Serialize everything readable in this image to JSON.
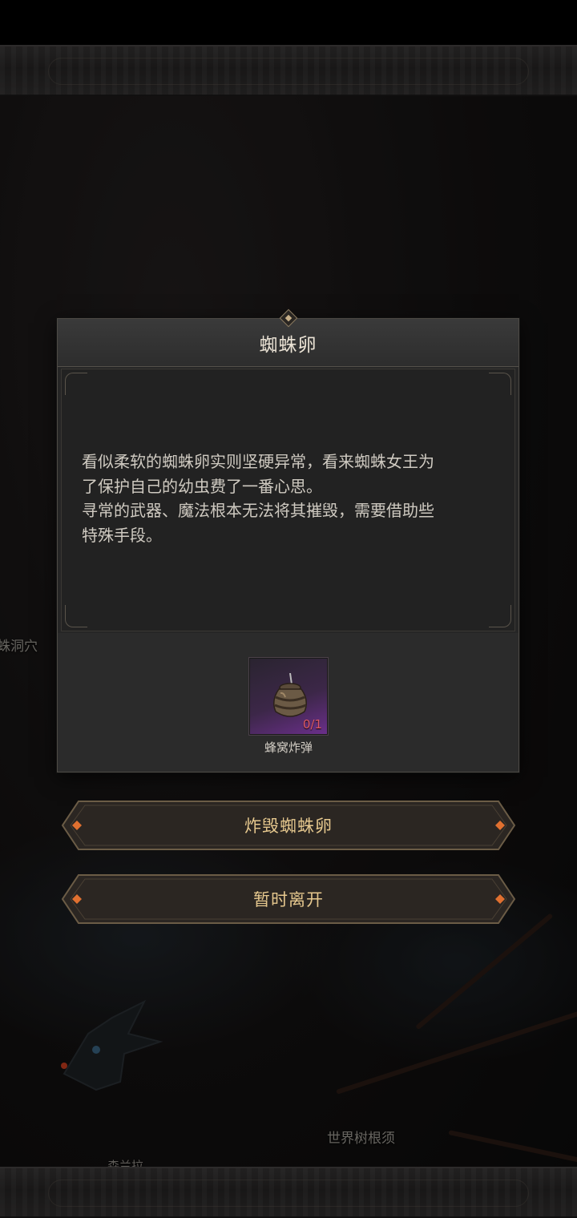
{
  "dialog": {
    "title": "蜘蛛卵",
    "description_lines": [
      "看似柔软的蜘蛛卵实则坚硬异常，看来蜘蛛女王为",
      "了保护自己的幼虫费了一番心思。",
      "寻常的武器、魔法根本无法将其摧毁，需要借助些",
      "特殊手段。"
    ],
    "required_item": {
      "name": "蜂窝炸弹",
      "count": "0/1",
      "icon": "honeycomb-bomb-icon"
    }
  },
  "actions": {
    "destroy_label": "炸毁蜘蛛卵",
    "leave_label": "暂时离开"
  },
  "map_labels": {
    "left": "蛛洞穴",
    "right": "世界树根须",
    "bottom": "森兰拉"
  },
  "colors": {
    "button_text": "#e6c88e",
    "count_text": "#e05a63",
    "item_rarity": "#6a2f8a"
  }
}
